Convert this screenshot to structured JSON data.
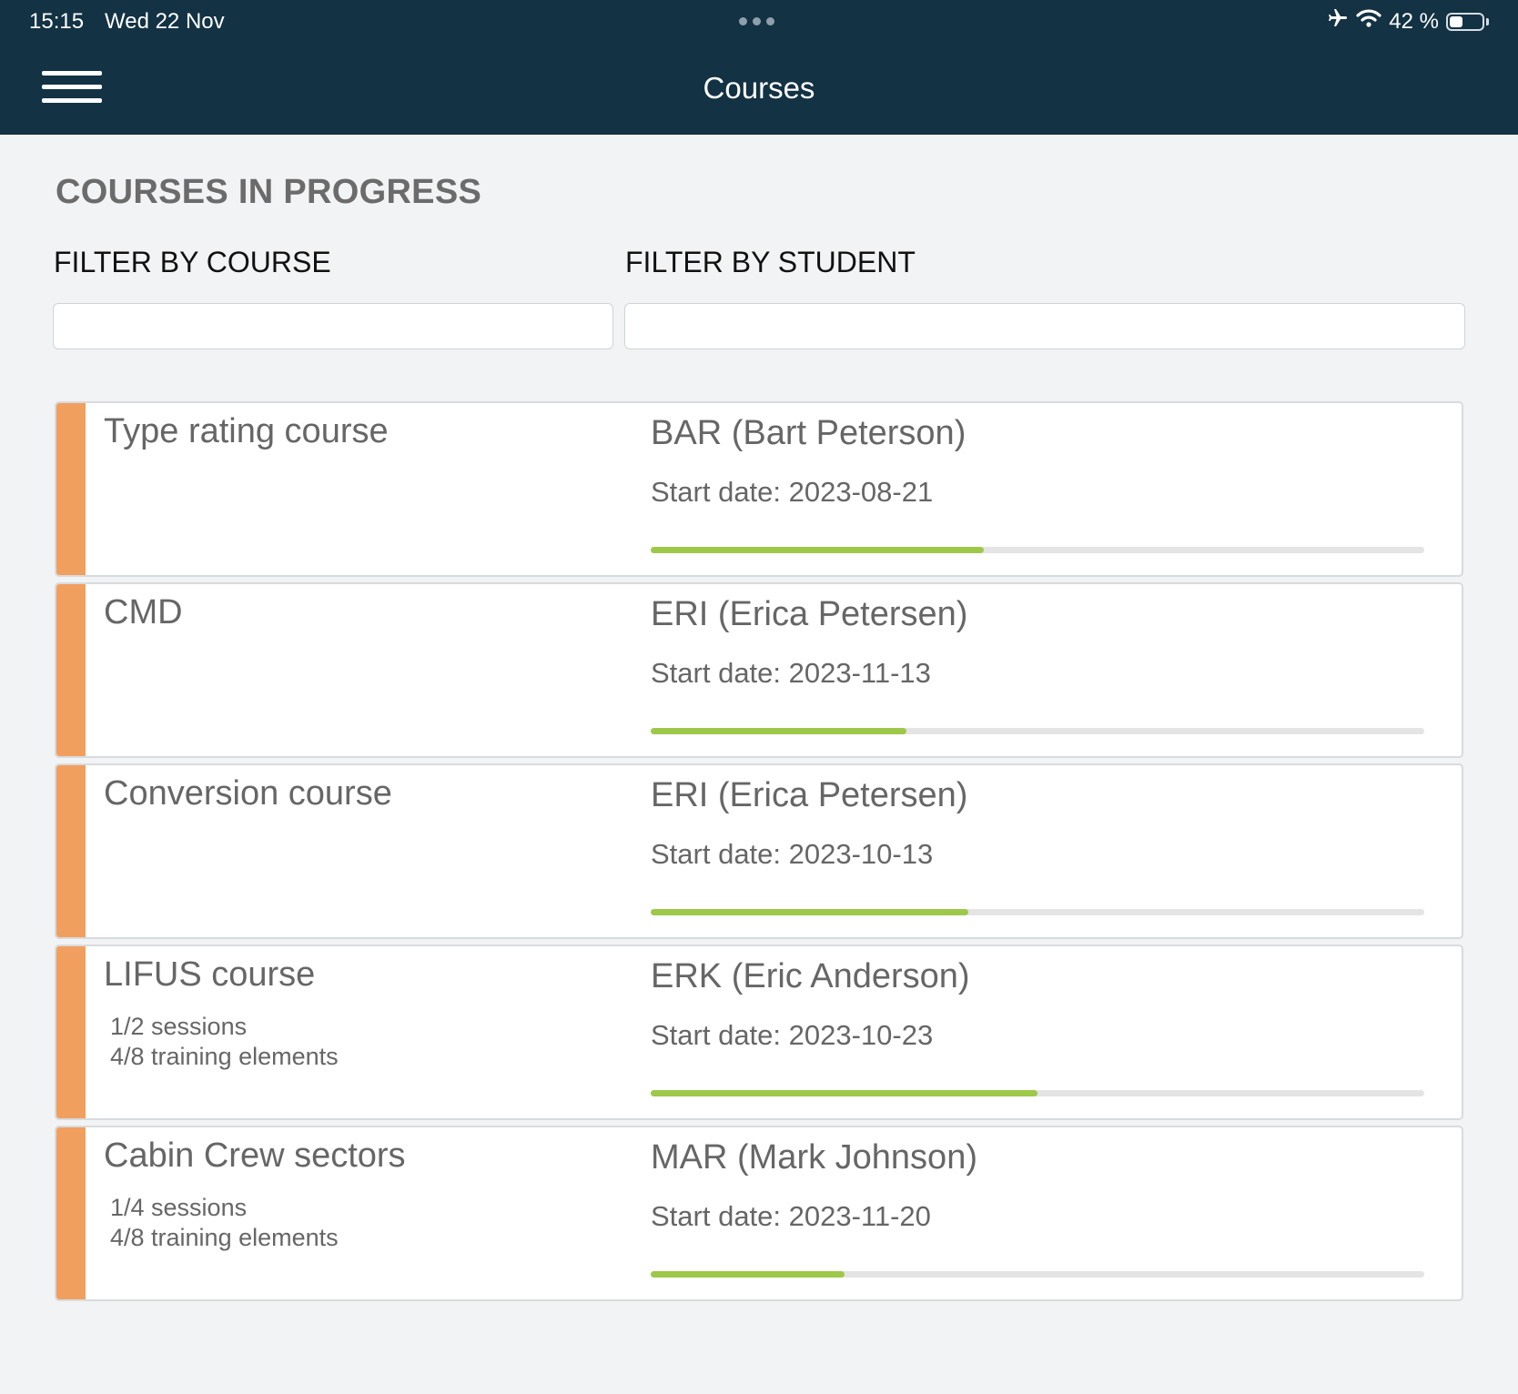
{
  "status_bar": {
    "time": "15:15",
    "date": "Wed 22 Nov",
    "battery_text": "42 %",
    "battery_level": 0.42,
    "icons": [
      "airplane-icon",
      "wifi-icon",
      "battery-icon"
    ]
  },
  "nav": {
    "title": "Courses",
    "menu_icon": "hamburger-menu-icon"
  },
  "page": {
    "section_title": "COURSES IN PROGRESS",
    "filter_course_label": "FILTER BY COURSE",
    "filter_course_value": "",
    "filter_student_label": "FILTER BY STUDENT",
    "filter_student_value": ""
  },
  "colors": {
    "header_bg": "#133244",
    "accent": "#f19f5e",
    "progress": "#9ec84a",
    "track": "#e4e4e4",
    "page_bg": "#f2f3f5"
  },
  "courses": [
    {
      "name": "Type rating course",
      "sessions": "",
      "elements": "",
      "student": "BAR (Bart Peterson)",
      "start_date": "Start date: 2023-08-21",
      "progress": 0.43
    },
    {
      "name": "CMD",
      "sessions": "",
      "elements": "",
      "student": "ERI (Erica Petersen)",
      "start_date": "Start date: 2023-11-13",
      "progress": 0.33
    },
    {
      "name": "Conversion course",
      "sessions": "",
      "elements": "",
      "student": "ERI (Erica Petersen)",
      "start_date": "Start date: 2023-10-13",
      "progress": 0.41
    },
    {
      "name": "LIFUS course",
      "sessions": "1/2 sessions",
      "elements": "4/8 training elements",
      "student": "ERK (Eric Anderson)",
      "start_date": "Start date: 2023-10-23",
      "progress": 0.5
    },
    {
      "name": "Cabin Crew sectors",
      "sessions": "1/4 sessions",
      "elements": "4/8 training elements",
      "student": "MAR (Mark Johnson)",
      "start_date": "Start date: 2023-11-20",
      "progress": 0.25
    }
  ]
}
